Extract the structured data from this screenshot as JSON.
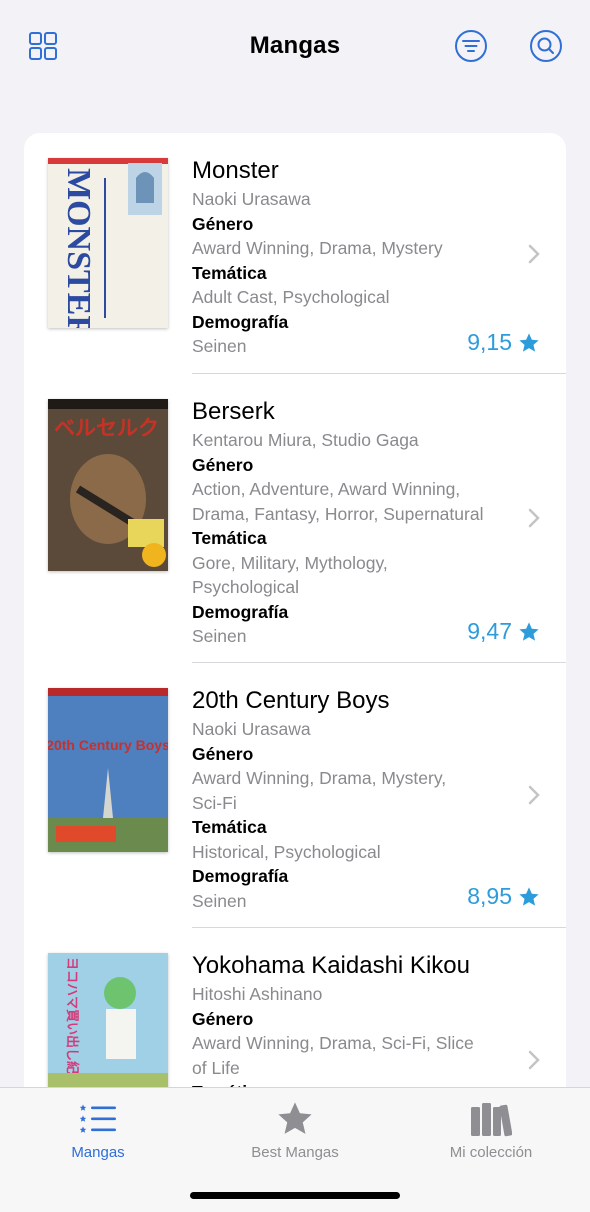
{
  "header": {
    "title": "Mangas",
    "left_icon": "grid-icon",
    "filter_icon": "filter-icon",
    "search_icon": "search-icon"
  },
  "accent_color": "#2f6fd6",
  "score_color": "#2d9cdb",
  "mangas": [
    {
      "title": "Monster",
      "author": "Naoki Urasawa",
      "genre_label": "Género",
      "genres": "Award Winning, Drama, Mystery",
      "theme_label": "Temática",
      "themes": "Adult Cast, Psychological",
      "demo_label": "Demografía",
      "demographic": "Seinen",
      "score": "9,15",
      "cover_text": "MONSTER"
    },
    {
      "title": "Berserk",
      "author": "Kentarou Miura, Studio Gaga",
      "genre_label": "Género",
      "genres_line1": "Action, Adventure, Award Winning,",
      "genres_line2": "Drama, Fantasy, Horror, Supernatural",
      "theme_label": "Temática",
      "themes_line1": "Gore, Military, Mythology,",
      "themes_line2": "Psychological",
      "demo_label": "Demografía",
      "demographic": "Seinen",
      "score": "9,47",
      "cover_text": "ベルセルク"
    },
    {
      "title": "20th Century Boys",
      "author": "Naoki Urasawa",
      "genre_label": "Género",
      "genres_line1": "Award Winning, Drama, Mystery,",
      "genres_line2": "Sci-Fi",
      "theme_label": "Temática",
      "themes": "Historical, Psychological",
      "demo_label": "Demografía",
      "demographic": "Seinen",
      "score": "8,95",
      "cover_text": "20th Century Boys"
    },
    {
      "title": "Yokohama Kaidashi Kikou",
      "author": "Hitoshi Ashinano",
      "genre_label": "Género",
      "genres_line1": "Award Winning, Drama, Sci-Fi, Slice",
      "genres_line2": "of Life",
      "theme_label": "Temática",
      "cover_text": "ヨコハマ買い出し紀行"
    }
  ],
  "tabs": [
    {
      "label": "Mangas",
      "icon": "list-icon",
      "active": true
    },
    {
      "label": "Best Mangas",
      "icon": "star-icon",
      "active": false
    },
    {
      "label": "Mi colección",
      "icon": "books-icon",
      "active": false
    }
  ]
}
